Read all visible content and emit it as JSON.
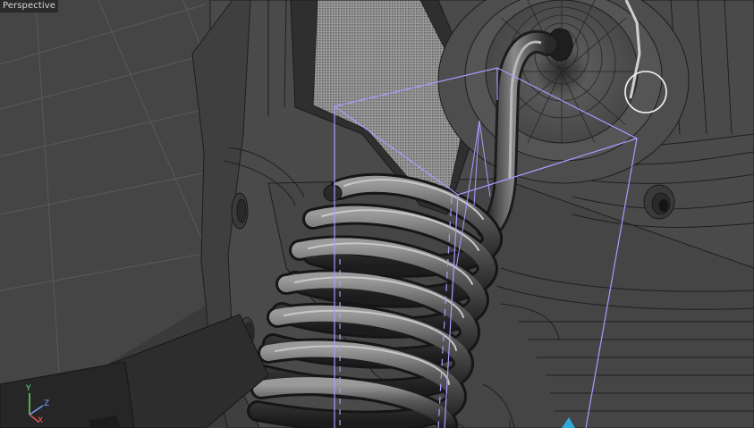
{
  "viewport": {
    "camera_label": "Perspective"
  },
  "axis_gizmo": {
    "y": "Y",
    "z": "Z",
    "x": "X"
  },
  "colors": {
    "background_floor": "#3a3a3a",
    "model_shading": "#4a4a4a",
    "wire_edges": "#1e1e1e",
    "selection_box": "#a89cff",
    "axis_x": "#ff5a5a",
    "axis_y": "#6ee26e",
    "axis_z": "#7aa2ff",
    "marker": "#2fa8e0"
  }
}
